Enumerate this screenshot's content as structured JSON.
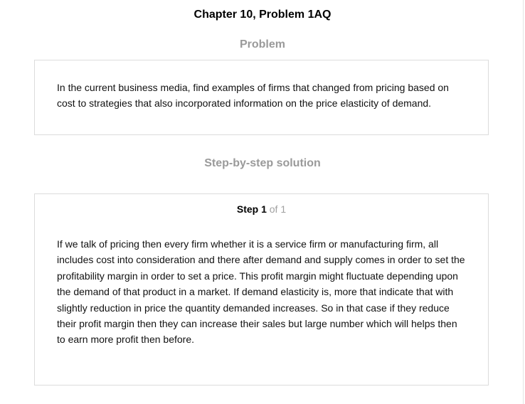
{
  "chapter_title": "Chapter 10, Problem 1AQ",
  "problem": {
    "heading": "Problem",
    "text": "In the current business media, find examples of firms that changed from pricing based on cost to strategies that also incorporated information on the price elasticity of demand."
  },
  "solution": {
    "heading": "Step-by-step solution",
    "step_label": "Step 1",
    "step_of": " of 1",
    "text": "If we talk of pricing then every firm whether it is a service firm or manufacturing firm, all includes cost into consideration and there after demand and supply comes in order to set the profitability margin in order to set a price. This profit margin might fluctuate depending upon the demand of that product in a market. If demand elasticity is, more that indicate that with slightly reduction in price the quantity demanded increases. So in that case if they reduce their profit margin then they can increase their sales but large number which will helps then to earn more profit then before."
  }
}
